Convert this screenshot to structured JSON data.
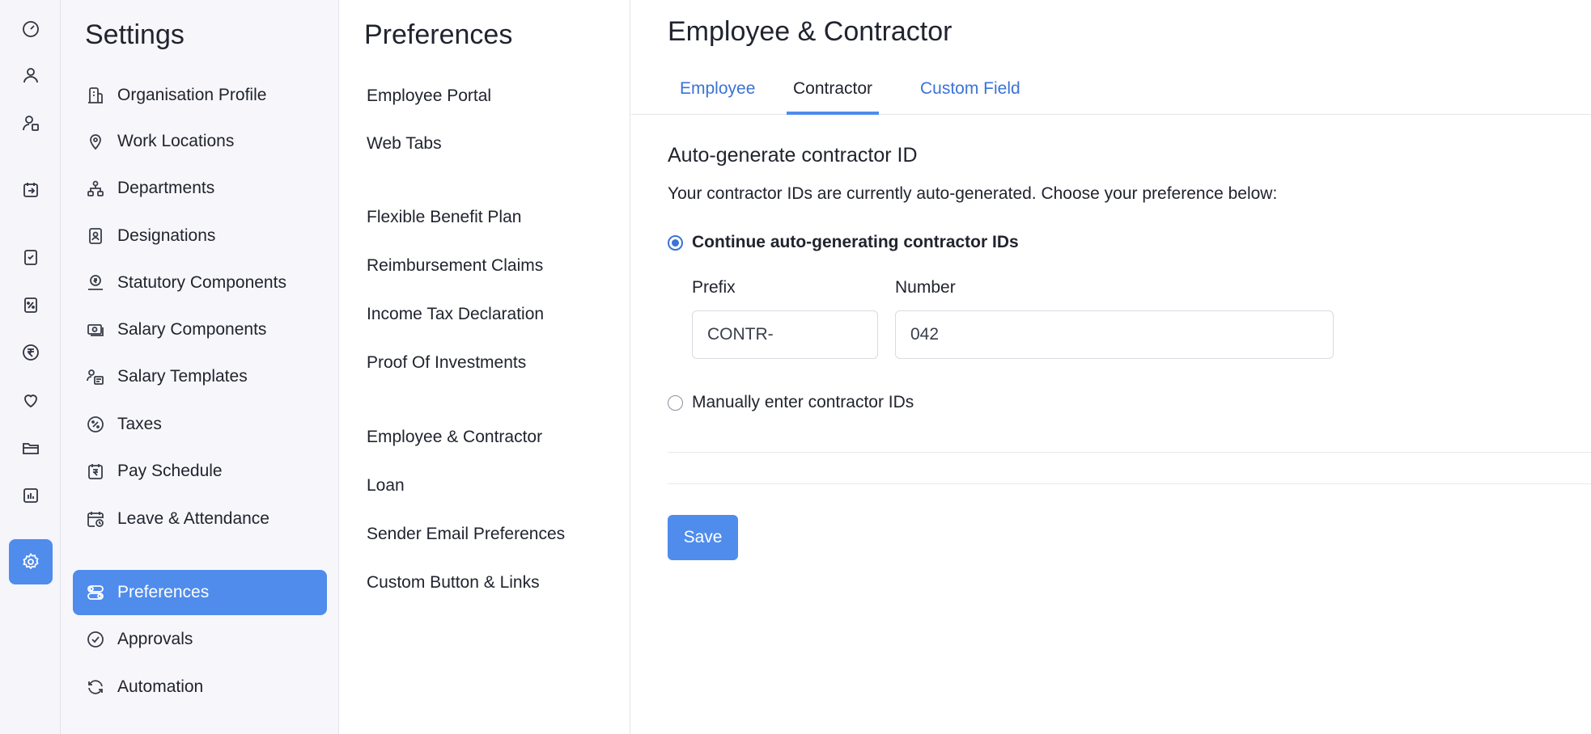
{
  "rail": {
    "icons": [
      "dashboard-icon",
      "employees-icon",
      "contractors-icon",
      "pay-runs-icon",
      "approvals-icon",
      "loans-icon",
      "payments-icon",
      "benefits-icon",
      "documents-icon",
      "reports-icon",
      "settings-icon"
    ]
  },
  "settings": {
    "title": "Settings",
    "items": [
      {
        "label": "Organisation Profile",
        "icon": "building-icon"
      },
      {
        "label": "Work Locations",
        "icon": "location-pin-icon"
      },
      {
        "label": "Departments",
        "icon": "org-chart-icon"
      },
      {
        "label": "Designations",
        "icon": "id-badge-icon"
      },
      {
        "label": "Statutory Components",
        "icon": "rupee-hand-icon"
      },
      {
        "label": "Salary Components",
        "icon": "cash-icon"
      },
      {
        "label": "Salary Templates",
        "icon": "user-template-icon"
      },
      {
        "label": "Taxes",
        "icon": "percent-circle-icon"
      },
      {
        "label": "Pay Schedule",
        "icon": "rupee-calendar-icon"
      },
      {
        "label": "Leave & Attendance",
        "icon": "calendar-clock-icon"
      },
      {
        "label": "Preferences",
        "icon": "toggles-icon"
      },
      {
        "label": "Approvals",
        "icon": "check-circle-icon"
      },
      {
        "label": "Automation",
        "icon": "refresh-icon"
      }
    ]
  },
  "preferences": {
    "title": "Preferences",
    "items": [
      "Employee Portal",
      "Web Tabs",
      "Flexible Benefit Plan",
      "Reimbursement Claims",
      "Income Tax Declaration",
      "Proof Of Investments",
      "Employee & Contractor",
      "Loan",
      "Sender Email Preferences",
      "Custom Button & Links"
    ]
  },
  "main": {
    "title": "Employee & Contractor",
    "tabs": [
      "Employee",
      "Contractor",
      "Custom Field"
    ],
    "active_tab": "Contractor",
    "section_title": "Auto-generate contractor ID",
    "section_desc": "Your contractor IDs are currently auto-generated. Choose your preference below:",
    "option_auto": "Continue auto-generating contractor IDs",
    "option_manual": "Manually enter contractor IDs",
    "prefix_label": "Prefix",
    "prefix_value": "CONTR-",
    "number_label": "Number",
    "number_value": "042",
    "save_label": "Save"
  },
  "colors": {
    "accent": "#4f8cec",
    "link": "#3b73d6",
    "sidebar_bg": "#f7f7fb"
  }
}
